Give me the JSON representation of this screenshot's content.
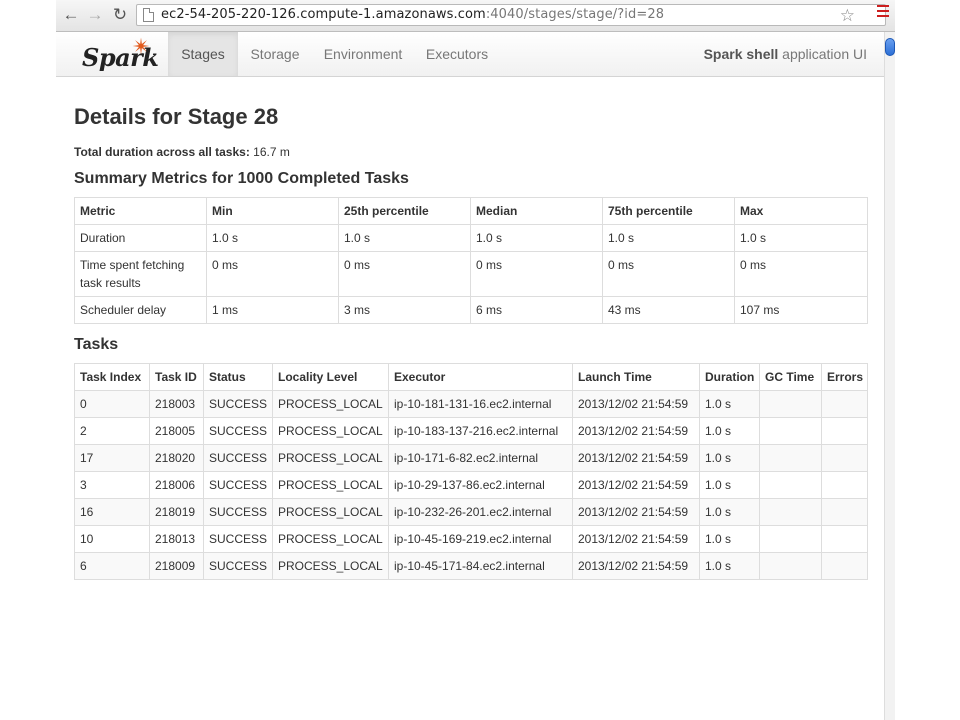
{
  "browser": {
    "url_host": "ec2-54-205-220-126.compute-1.amazonaws.com",
    "url_rest": ":4040/stages/stage/?id=28",
    "back_icon": "back-arrow-icon",
    "forward_icon": "forward-arrow-icon",
    "reload_icon": "reload-icon"
  },
  "navbar": {
    "brand": "Spark",
    "tabs": [
      {
        "label": "Stages",
        "active": true
      },
      {
        "label": "Storage",
        "active": false
      },
      {
        "label": "Environment",
        "active": false
      },
      {
        "label": "Executors",
        "active": false
      }
    ],
    "app_name": "Spark shell",
    "app_suffix": " application UI"
  },
  "page": {
    "title": "Details for Stage 28",
    "duration_label": "Total duration across all tasks:",
    "duration_value": " 16.7 m"
  },
  "summary": {
    "title": "Summary Metrics for 1000 Completed Tasks",
    "headers": [
      "Metric",
      "Min",
      "25th percentile",
      "Median",
      "75th percentile",
      "Max"
    ],
    "rows": [
      [
        "Duration",
        "1.0 s",
        "1.0 s",
        "1.0 s",
        "1.0 s",
        "1.0 s"
      ],
      [
        "Time spent fetching task results",
        "0 ms",
        "0 ms",
        "0 ms",
        "0 ms",
        "0 ms"
      ],
      [
        "Scheduler delay",
        "1 ms",
        "3 ms",
        "6 ms",
        "43 ms",
        "107 ms"
      ]
    ]
  },
  "tasks": {
    "title": "Tasks",
    "headers": [
      "Task Index",
      "Task ID",
      "Status",
      "Locality Level",
      "Executor",
      "Launch Time",
      "Duration",
      "GC Time",
      "Errors"
    ],
    "rows": [
      [
        "0",
        "218003",
        "SUCCESS",
        "PROCESS_LOCAL",
        "ip-10-181-131-16.ec2.internal",
        "2013/12/02 21:54:59",
        "1.0 s",
        "",
        ""
      ],
      [
        "2",
        "218005",
        "SUCCESS",
        "PROCESS_LOCAL",
        "ip-10-183-137-216.ec2.internal",
        "2013/12/02 21:54:59",
        "1.0 s",
        "",
        ""
      ],
      [
        "17",
        "218020",
        "SUCCESS",
        "PROCESS_LOCAL",
        "ip-10-171-6-82.ec2.internal",
        "2013/12/02 21:54:59",
        "1.0 s",
        "",
        ""
      ],
      [
        "3",
        "218006",
        "SUCCESS",
        "PROCESS_LOCAL",
        "ip-10-29-137-86.ec2.internal",
        "2013/12/02 21:54:59",
        "1.0 s",
        "",
        ""
      ],
      [
        "16",
        "218019",
        "SUCCESS",
        "PROCESS_LOCAL",
        "ip-10-232-26-201.ec2.internal",
        "2013/12/02 21:54:59",
        "1.0 s",
        "",
        ""
      ],
      [
        "10",
        "218013",
        "SUCCESS",
        "PROCESS_LOCAL",
        "ip-10-45-169-219.ec2.internal",
        "2013/12/02 21:54:59",
        "1.0 s",
        "",
        ""
      ],
      [
        "6",
        "218009",
        "SUCCESS",
        "PROCESS_LOCAL",
        "ip-10-45-171-84.ec2.internal",
        "2013/12/02 21:54:59",
        "1.0 s",
        "",
        ""
      ]
    ]
  }
}
